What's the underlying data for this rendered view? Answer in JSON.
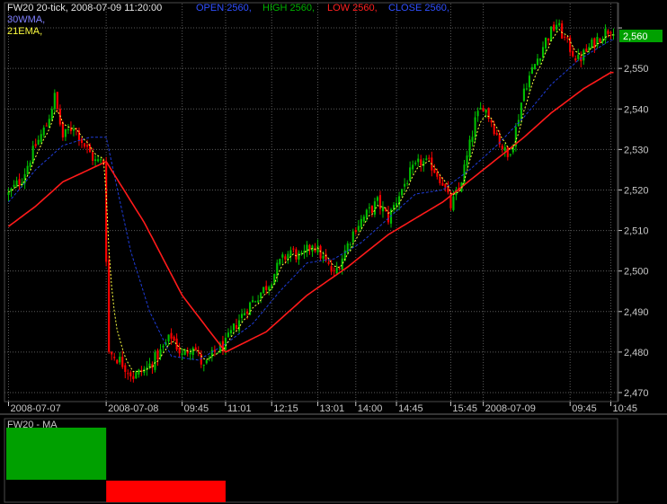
{
  "header": {
    "symbol_line": "FW20 20-tick, 2008-07-09 11:20:00",
    "open": "OPEN 2560,",
    "high": "HIGH 2560,",
    "low": "LOW 2560,",
    "close": "CLOSE 2560,",
    "wma_label": "30WMA,",
    "ema_label": "21EMA,"
  },
  "last_price_label": "2,560",
  "indicator_panel": {
    "title": "FW20 - MA",
    "segments": [
      {
        "from_label": 0,
        "to_label": 1,
        "state": "up"
      },
      {
        "from_label": 1,
        "to_label": 3,
        "state": "down"
      },
      {
        "from_label": 3,
        "to_label": 13,
        "state": "up"
      }
    ]
  },
  "colors": {
    "background": "#000000",
    "grid": "#5a5a5a",
    "axis_text": "#c8c8c8",
    "bull": "#00c000",
    "bear": "#ff0000",
    "wma": "#1e3cd8",
    "ema": "#ffff40",
    "slow_ma": "#ff1a1a",
    "open_text": "#3050ff",
    "high_text": "#00b000",
    "low_text": "#ff2020",
    "close_text": "#3050ff",
    "wma_text": "#8080ff",
    "ema_text": "#ffff40",
    "price_tag": "#00a000",
    "panel_up": "#00a000",
    "panel_down": "#ff0000"
  },
  "chart_data": {
    "type": "candlestick",
    "ylim": [
      2468,
      2566
    ],
    "yticks": [
      2470,
      2480,
      2490,
      2500,
      2510,
      2520,
      2530,
      2540,
      2550,
      2560
    ],
    "ytick_labels": [
      "2,470",
      "2,480",
      "2,490",
      "2,500",
      "2,510",
      "2,520",
      "2,530",
      "2,540",
      "2,550",
      ""
    ],
    "xticks": [
      {
        "label": "2008-07-07",
        "bar": 0
      },
      {
        "label": "2008-07-08",
        "bar": 36
      },
      {
        "label": "09:45",
        "bar": 64
      },
      {
        "label": "11:01",
        "bar": 80
      },
      {
        "label": "12:15",
        "bar": 97
      },
      {
        "label": "13:01",
        "bar": 114
      },
      {
        "label": "14:00",
        "bar": 128
      },
      {
        "label": "14:45",
        "bar": 143
      },
      {
        "label": "15:45",
        "bar": 163
      },
      {
        "label": "2008-07-09",
        "bar": 175
      },
      {
        "label": "09:45",
        "bar": 207
      },
      {
        "label": "10:45",
        "bar": 222
      }
    ],
    "close_anchors": [
      [
        0,
        2519
      ],
      [
        5,
        2523
      ],
      [
        10,
        2531
      ],
      [
        14,
        2536
      ],
      [
        17,
        2543
      ],
      [
        20,
        2533
      ],
      [
        24,
        2536
      ],
      [
        28,
        2531
      ],
      [
        32,
        2527
      ],
      [
        35,
        2527
      ],
      [
        37,
        2480
      ],
      [
        41,
        2478
      ],
      [
        46,
        2474
      ],
      [
        51,
        2476
      ],
      [
        56,
        2480
      ],
      [
        60,
        2484
      ],
      [
        64,
        2479
      ],
      [
        68,
        2482
      ],
      [
        72,
        2476
      ],
      [
        76,
        2480
      ],
      [
        80,
        2482
      ],
      [
        84,
        2487
      ],
      [
        88,
        2491
      ],
      [
        92,
        2494
      ],
      [
        96,
        2497
      ],
      [
        100,
        2502
      ],
      [
        104,
        2505
      ],
      [
        108,
        2503
      ],
      [
        112,
        2507
      ],
      [
        116,
        2503
      ],
      [
        120,
        2499
      ],
      [
        124,
        2505
      ],
      [
        128,
        2511
      ],
      [
        132,
        2514
      ],
      [
        136,
        2517
      ],
      [
        140,
        2513
      ],
      [
        144,
        2519
      ],
      [
        148,
        2524
      ],
      [
        152,
        2527
      ],
      [
        156,
        2526
      ],
      [
        160,
        2522
      ],
      [
        163,
        2516
      ],
      [
        166,
        2520
      ],
      [
        169,
        2528
      ],
      [
        172,
        2537
      ],
      [
        175,
        2541
      ],
      [
        178,
        2537
      ],
      [
        181,
        2532
      ],
      [
        184,
        2528
      ],
      [
        187,
        2535
      ],
      [
        190,
        2545
      ],
      [
        194,
        2551
      ],
      [
        198,
        2557
      ],
      [
        202,
        2561
      ],
      [
        206,
        2556
      ],
      [
        210,
        2552
      ],
      [
        214,
        2555
      ],
      [
        218,
        2558
      ],
      [
        222,
        2560
      ]
    ],
    "wma_anchors": [
      [
        0,
        2517
      ],
      [
        10,
        2525
      ],
      [
        20,
        2531
      ],
      [
        30,
        2533
      ],
      [
        36,
        2533
      ],
      [
        45,
        2505
      ],
      [
        52,
        2490
      ],
      [
        60,
        2479
      ],
      [
        70,
        2478
      ],
      [
        80,
        2482
      ],
      [
        90,
        2487
      ],
      [
        100,
        2495
      ],
      [
        110,
        2502
      ],
      [
        120,
        2503
      ],
      [
        130,
        2507
      ],
      [
        140,
        2513
      ],
      [
        150,
        2519
      ],
      [
        160,
        2520
      ],
      [
        170,
        2525
      ],
      [
        180,
        2531
      ],
      [
        190,
        2538
      ],
      [
        200,
        2546
      ],
      [
        210,
        2552
      ],
      [
        222,
        2557
      ]
    ],
    "slow_ma_anchors": [
      [
        0,
        2511
      ],
      [
        10,
        2516
      ],
      [
        20,
        2522
      ],
      [
        36,
        2527
      ],
      [
        50,
        2512
      ],
      [
        64,
        2494
      ],
      [
        80,
        2480
      ],
      [
        95,
        2485
      ],
      [
        110,
        2494
      ],
      [
        125,
        2501
      ],
      [
        140,
        2509
      ],
      [
        160,
        2517
      ],
      [
        175,
        2525
      ],
      [
        190,
        2533
      ],
      [
        200,
        2539
      ],
      [
        212,
        2545
      ],
      [
        222,
        2549
      ]
    ],
    "bar_count": 224
  }
}
